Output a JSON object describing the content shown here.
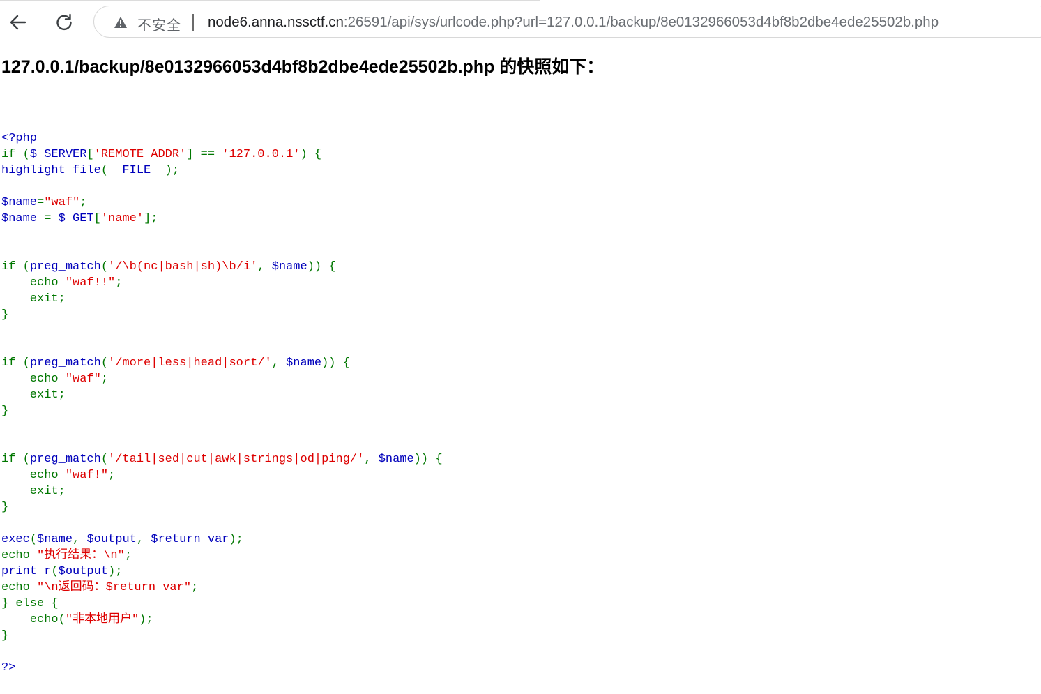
{
  "browser": {
    "security_label": "不安全",
    "url_host": "node6.anna.nssctf.cn",
    "url_rest": ":26591/api/sys/urlcode.php?url=127.0.0.1/backup/8e0132966053d4bf8b2dbe4ede25502b.php"
  },
  "page": {
    "heading": "127.0.0.1/backup/8e0132966053d4bf8b2dbe4ede25502b.php 的快照如下：",
    "code_lines": [
      [
        {
          "t": "<?php",
          "c": "default"
        }
      ],
      [
        {
          "t": "if ",
          "c": "keyword"
        },
        {
          "t": "(",
          "c": "keyword"
        },
        {
          "t": "$_SERVER",
          "c": "default"
        },
        {
          "t": "[",
          "c": "keyword"
        },
        {
          "t": "'REMOTE_ADDR'",
          "c": "string"
        },
        {
          "t": "] ",
          "c": "keyword"
        },
        {
          "t": "== ",
          "c": "keyword"
        },
        {
          "t": "'127.0.0.1'",
          "c": "string"
        },
        {
          "t": ") {",
          "c": "keyword"
        }
      ],
      [
        {
          "t": "highlight_file",
          "c": "default"
        },
        {
          "t": "(",
          "c": "keyword"
        },
        {
          "t": "__FILE__",
          "c": "default"
        },
        {
          "t": ");",
          "c": "keyword"
        }
      ],
      [],
      [
        {
          "t": "$name",
          "c": "default"
        },
        {
          "t": "=",
          "c": "keyword"
        },
        {
          "t": "\"waf\"",
          "c": "string"
        },
        {
          "t": ";",
          "c": "keyword"
        }
      ],
      [
        {
          "t": "$name ",
          "c": "default"
        },
        {
          "t": "= ",
          "c": "keyword"
        },
        {
          "t": "$_GET",
          "c": "default"
        },
        {
          "t": "[",
          "c": "keyword"
        },
        {
          "t": "'name'",
          "c": "string"
        },
        {
          "t": "];",
          "c": "keyword"
        }
      ],
      [],
      [],
      [
        {
          "t": "if ",
          "c": "keyword"
        },
        {
          "t": "(",
          "c": "keyword"
        },
        {
          "t": "preg_match",
          "c": "default"
        },
        {
          "t": "(",
          "c": "keyword"
        },
        {
          "t": "'/\\b(nc|bash|sh)\\b/i'",
          "c": "string"
        },
        {
          "t": ", ",
          "c": "keyword"
        },
        {
          "t": "$name",
          "c": "default"
        },
        {
          "t": ")) {",
          "c": "keyword"
        }
      ],
      [
        {
          "t": "    echo ",
          "c": "keyword"
        },
        {
          "t": "\"waf!!\"",
          "c": "string"
        },
        {
          "t": ";",
          "c": "keyword"
        }
      ],
      [
        {
          "t": "    exit;",
          "c": "keyword"
        }
      ],
      [
        {
          "t": "}",
          "c": "keyword"
        }
      ],
      [],
      [],
      [
        {
          "t": "if ",
          "c": "keyword"
        },
        {
          "t": "(",
          "c": "keyword"
        },
        {
          "t": "preg_match",
          "c": "default"
        },
        {
          "t": "(",
          "c": "keyword"
        },
        {
          "t": "'/more|less|head|sort/'",
          "c": "string"
        },
        {
          "t": ", ",
          "c": "keyword"
        },
        {
          "t": "$name",
          "c": "default"
        },
        {
          "t": ")) {",
          "c": "keyword"
        }
      ],
      [
        {
          "t": "    echo ",
          "c": "keyword"
        },
        {
          "t": "\"waf\"",
          "c": "string"
        },
        {
          "t": ";",
          "c": "keyword"
        }
      ],
      [
        {
          "t": "    exit;",
          "c": "keyword"
        }
      ],
      [
        {
          "t": "}",
          "c": "keyword"
        }
      ],
      [],
      [],
      [
        {
          "t": "if ",
          "c": "keyword"
        },
        {
          "t": "(",
          "c": "keyword"
        },
        {
          "t": "preg_match",
          "c": "default"
        },
        {
          "t": "(",
          "c": "keyword"
        },
        {
          "t": "'/tail|sed|cut|awk|strings|od|ping/'",
          "c": "string"
        },
        {
          "t": ", ",
          "c": "keyword"
        },
        {
          "t": "$name",
          "c": "default"
        },
        {
          "t": ")) {",
          "c": "keyword"
        }
      ],
      [
        {
          "t": "    echo ",
          "c": "keyword"
        },
        {
          "t": "\"waf!\"",
          "c": "string"
        },
        {
          "t": ";",
          "c": "keyword"
        }
      ],
      [
        {
          "t": "    exit;",
          "c": "keyword"
        }
      ],
      [
        {
          "t": "}",
          "c": "keyword"
        }
      ],
      [],
      [
        {
          "t": "exec",
          "c": "default"
        },
        {
          "t": "(",
          "c": "keyword"
        },
        {
          "t": "$name",
          "c": "default"
        },
        {
          "t": ", ",
          "c": "keyword"
        },
        {
          "t": "$output",
          "c": "default"
        },
        {
          "t": ", ",
          "c": "keyword"
        },
        {
          "t": "$return_var",
          "c": "default"
        },
        {
          "t": ");",
          "c": "keyword"
        }
      ],
      [
        {
          "t": "echo ",
          "c": "keyword"
        },
        {
          "t": "\"执行结果：\\n\"",
          "c": "string"
        },
        {
          "t": ";",
          "c": "keyword"
        }
      ],
      [
        {
          "t": "print_r",
          "c": "default"
        },
        {
          "t": "(",
          "c": "keyword"
        },
        {
          "t": "$output",
          "c": "default"
        },
        {
          "t": ");",
          "c": "keyword"
        }
      ],
      [
        {
          "t": "echo ",
          "c": "keyword"
        },
        {
          "t": "\"\\n返回码：$return_var\"",
          "c": "string"
        },
        {
          "t": ";",
          "c": "keyword"
        }
      ],
      [
        {
          "t": "} else {",
          "c": "keyword"
        }
      ],
      [
        {
          "t": "    echo",
          "c": "keyword"
        },
        {
          "t": "(",
          "c": "keyword"
        },
        {
          "t": "\"非本地用户\"",
          "c": "string"
        },
        {
          "t": ");",
          "c": "keyword"
        }
      ],
      [
        {
          "t": "}",
          "c": "keyword"
        }
      ],
      [],
      [
        {
          "t": "?>",
          "c": "default"
        }
      ]
    ]
  }
}
